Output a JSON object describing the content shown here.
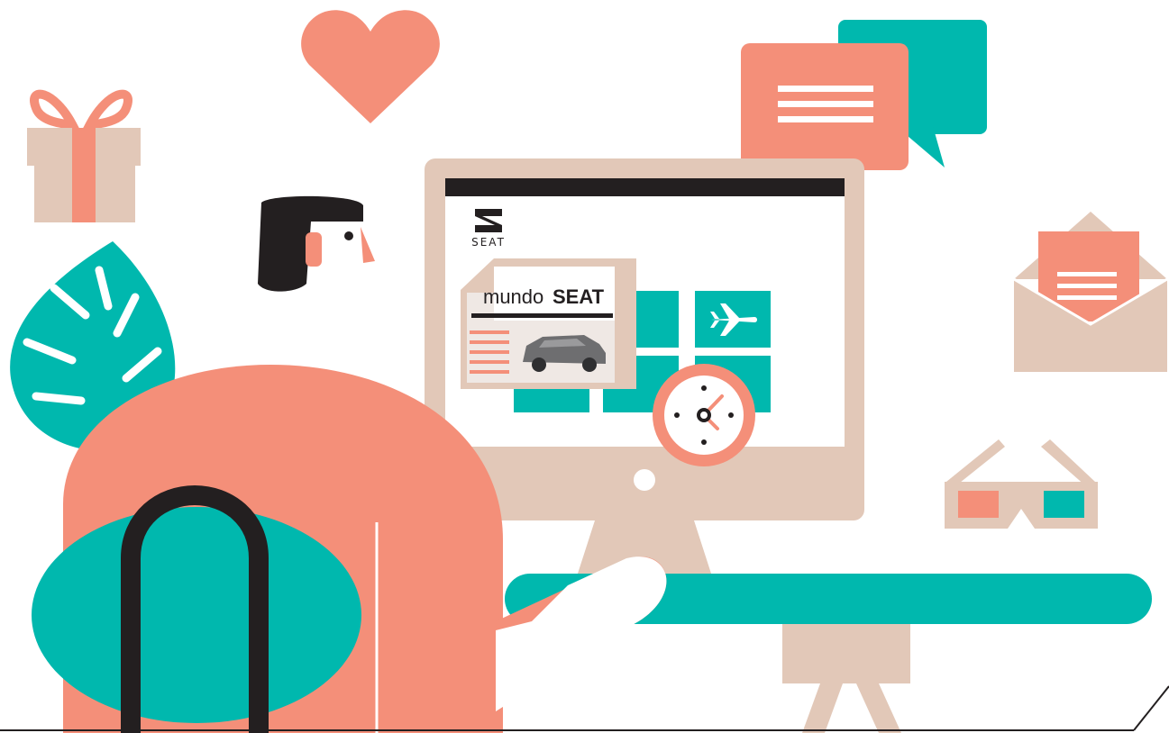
{
  "brand": {
    "logo_text": "SEAT"
  },
  "magazine": {
    "title_light": "mundo",
    "title_bold": "SEAT"
  },
  "colors": {
    "coral": "#F48F79",
    "teal": "#00B8AE",
    "beige": "#E2C8B8",
    "dark": "#231F20",
    "white": "#FFFFFF",
    "paper": "#EFE8E4",
    "car": "#6E6E70"
  },
  "icons": [
    "gift-icon",
    "heart-icon",
    "leaf-icon",
    "chat-bubbles-icon",
    "envelope-icon",
    "3d-glasses-icon",
    "clock-icon",
    "airplane-icon",
    "seat-logo-icon"
  ]
}
